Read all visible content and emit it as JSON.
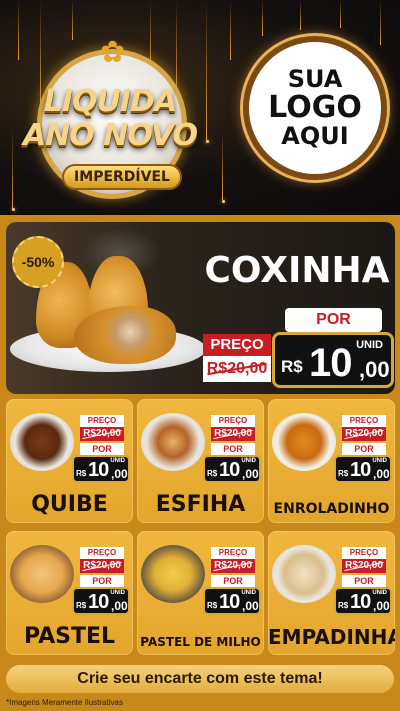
{
  "header": {
    "badge": {
      "line1": "LIQUIDA",
      "line2": "ANO NOVO",
      "ribbon": "IMPERDÍVEL"
    },
    "logo": {
      "line1": "SUA",
      "line2": "LOGO",
      "line3": "AQUI"
    }
  },
  "featured": {
    "discount": "-50%",
    "name": "COXINHA",
    "preco_label": "PREÇO",
    "old_price": "R$20,00",
    "por_label": "POR",
    "unid_label": "UNID",
    "currency": "R$",
    "price_int": "10",
    "price_dec": ",00"
  },
  "products": [
    {
      "name": "QUIBE",
      "preco_label": "PREÇO",
      "old_price": "R$20,00",
      "por_label": "POR",
      "unid_label": "UNID",
      "currency": "R$",
      "price_int": "10",
      "price_dec": ",00"
    },
    {
      "name": "ESFIHA",
      "preco_label": "PREÇO",
      "old_price": "R$20,00",
      "por_label": "POR",
      "unid_label": "UNID",
      "currency": "R$",
      "price_int": "10",
      "price_dec": ",00"
    },
    {
      "name": "ENROLADINHO",
      "preco_label": "PREÇO",
      "old_price": "R$20,00",
      "por_label": "POR",
      "unid_label": "UNID",
      "currency": "R$",
      "price_int": "10",
      "price_dec": ",00"
    },
    {
      "name": "PASTEL",
      "preco_label": "PREÇO",
      "old_price": "R$20,00",
      "por_label": "POR",
      "unid_label": "UNID",
      "currency": "R$",
      "price_int": "10",
      "price_dec": ",00"
    },
    {
      "name": "PASTEL DE MILHO",
      "preco_label": "PREÇO",
      "old_price": "R$20,00",
      "por_label": "POR",
      "unid_label": "UNID",
      "currency": "R$",
      "price_int": "10",
      "price_dec": ",00"
    },
    {
      "name": "EMPADINHA",
      "preco_label": "PREÇO",
      "old_price": "R$20,00",
      "por_label": "POR",
      "unid_label": "UNID",
      "currency": "R$",
      "price_int": "10",
      "price_dec": ",00"
    }
  ],
  "cta": "Crie seu encarte com este tema!",
  "footnote": "*Imagens Meramente Ilustrativas",
  "colors": {
    "background": "#c9891a",
    "card": "#e3a62c",
    "price_red": "#c81d25",
    "price_box": "#111111",
    "gold_border": "#d9a63a"
  }
}
